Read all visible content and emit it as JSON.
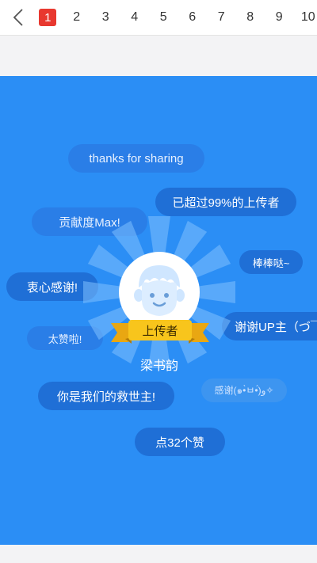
{
  "pager": {
    "back_icon": "chevron-left-icon",
    "pages": [
      "1",
      "2",
      "3",
      "4",
      "5",
      "6",
      "7",
      "8",
      "9",
      "10"
    ],
    "current": "1",
    "accent": "#e8382f"
  },
  "card": {
    "background": "#2b8ef5",
    "bubbles": {
      "thanks": "thanks for sharing",
      "percent": "已超过99%的上传者",
      "contribution": "贡献度Max!",
      "great": "棒棒哒~",
      "heartfelt": "衷心感谢!",
      "thank_up": "谢谢UP主（づ￣",
      "awesome": "太赞啦!",
      "thanks_face": "感谢(๑•̀ㅂ•́)و✧",
      "savior": "你是我们的救世主!",
      "likes": "点32个赞"
    },
    "uploader": {
      "badge": "上传者",
      "name": "梁书韵"
    }
  }
}
